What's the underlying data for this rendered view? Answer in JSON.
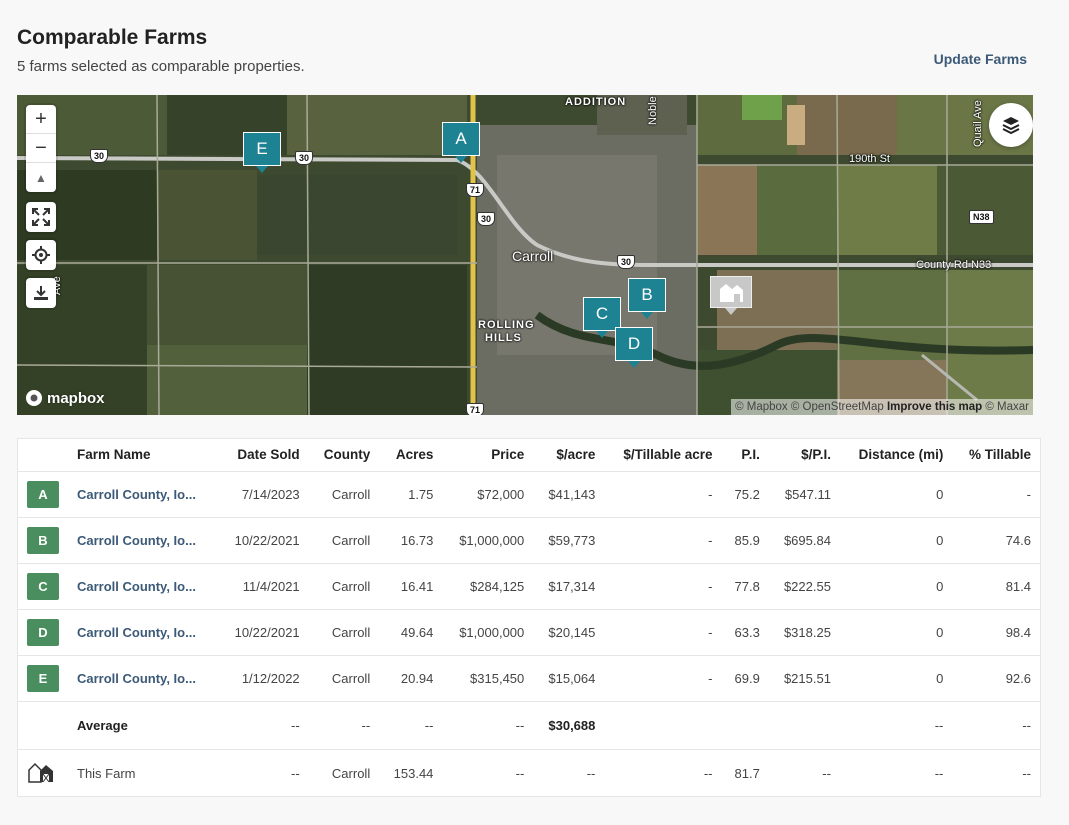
{
  "header": {
    "title": "Comparable Farms",
    "subtitle": "5 farms selected as comparable properties.",
    "update_label": "Update Farms"
  },
  "map": {
    "controls": {
      "zoom_in": "+",
      "zoom_out": "−",
      "compass": "▲"
    },
    "markers": [
      {
        "label": "A"
      },
      {
        "label": "B"
      },
      {
        "label": "C"
      },
      {
        "label": "D"
      },
      {
        "label": "E"
      }
    ],
    "place_labels": {
      "addition": "ADDITION",
      "carroll": "Carroll",
      "rolling_hills_1": "ROLLING",
      "rolling_hills_2": "HILLS",
      "noble_ave": "Noble Ave",
      "quail_ave": "Quail Ave",
      "st_190th": "190th St",
      "county_rd": "County Rd N33",
      "west_ave": "Ave"
    },
    "shields": {
      "us30_a": "30",
      "us30_b": "30",
      "us30_c": "30",
      "us30_d": "30",
      "us71_a": "71",
      "us71_b": "71",
      "n38": "N38"
    },
    "logo": "mapbox",
    "attribution": {
      "mapbox": "© Mapbox",
      "osm": "© OpenStreetMap",
      "improve": "Improve this map",
      "maxar": "© Maxar"
    }
  },
  "table": {
    "columns": [
      "Farm Name",
      "Date Sold",
      "County",
      "Acres",
      "Price",
      "$/acre",
      "$/Tillable acre",
      "P.I.",
      "$/P.I.",
      "Distance (mi)",
      "% Tillable"
    ],
    "rows": [
      {
        "badge": "A",
        "name": "Carroll County, Io...",
        "date": "7/14/2023",
        "county": "Carroll",
        "acres": "1.75",
        "price": "$72,000",
        "per_acre": "$41,143",
        "per_tillable": "-",
        "pi": "75.2",
        "per_pi": "$547.11",
        "distance": "0",
        "pct_tillable": "-"
      },
      {
        "badge": "B",
        "name": "Carroll County, Io...",
        "date": "10/22/2021",
        "county": "Carroll",
        "acres": "16.73",
        "price": "$1,000,000",
        "per_acre": "$59,773",
        "per_tillable": "-",
        "pi": "85.9",
        "per_pi": "$695.84",
        "distance": "0",
        "pct_tillable": "74.6"
      },
      {
        "badge": "C",
        "name": "Carroll County, Io...",
        "date": "11/4/2021",
        "county": "Carroll",
        "acres": "16.41",
        "price": "$284,125",
        "per_acre": "$17,314",
        "per_tillable": "-",
        "pi": "77.8",
        "per_pi": "$222.55",
        "distance": "0",
        "pct_tillable": "81.4"
      },
      {
        "badge": "D",
        "name": "Carroll County, Io...",
        "date": "10/22/2021",
        "county": "Carroll",
        "acres": "49.64",
        "price": "$1,000,000",
        "per_acre": "$20,145",
        "per_tillable": "-",
        "pi": "63.3",
        "per_pi": "$318.25",
        "distance": "0",
        "pct_tillable": "98.4"
      },
      {
        "badge": "E",
        "name": "Carroll County, Io...",
        "date": "1/12/2022",
        "county": "Carroll",
        "acres": "20.94",
        "price": "$315,450",
        "per_acre": "$15,064",
        "per_tillable": "-",
        "pi": "69.9",
        "per_pi": "$215.51",
        "distance": "0",
        "pct_tillable": "92.6"
      }
    ],
    "average": {
      "label": "Average",
      "date": "--",
      "county": "--",
      "acres": "--",
      "price": "--",
      "per_acre": "$30,688",
      "per_tillable": "",
      "pi": "",
      "per_pi": "",
      "distance": "--",
      "pct_tillable": "--"
    },
    "this_farm": {
      "label": "This Farm",
      "date": "--",
      "county": "Carroll",
      "acres": "153.44",
      "price": "--",
      "per_acre": "--",
      "per_tillable": "--",
      "pi": "81.7",
      "per_pi": "--",
      "distance": "--",
      "pct_tillable": "--"
    }
  },
  "colors": {
    "badge_green": "#4a8d5f",
    "marker_teal": "#1d8292",
    "link_blue": "#3c5a78"
  }
}
